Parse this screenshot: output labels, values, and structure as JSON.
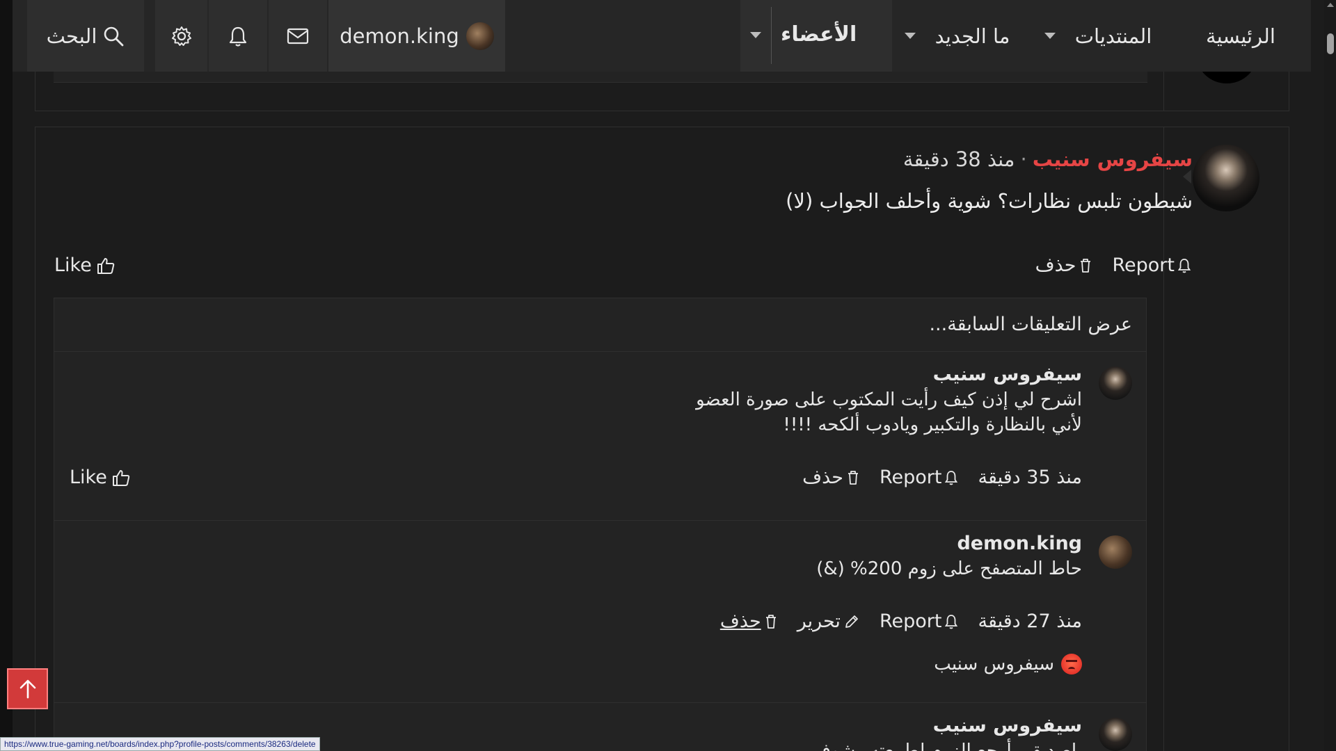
{
  "nav": {
    "home": "الرئيسية",
    "forums": "المنتديات",
    "whats_new": "ما الجديد",
    "members": "الأعضاء",
    "username": "demon.king",
    "search": "البحث"
  },
  "post": {
    "author": "سيفروس سنيب",
    "separator": "·",
    "time": "منذ 38 دقيقة",
    "body": "شيطون تلبس نظارات؟ شوية وأحلف الجواب (لا)",
    "report": "Report",
    "delete": "حذف",
    "like": "Like"
  },
  "comments": {
    "load_previous": "عرض التعليقات السابقة...",
    "items": [
      {
        "author": "سيفروس سنيب",
        "line1": "اشرح لي إذن كيف رأيت المكتوب على صورة العضو",
        "line2": "لأني بالنظارة والتكبير ويادوب ألكحه !!!!",
        "time": "منذ 35 دقيقة",
        "report": "Report",
        "delete": "حذف",
        "like": "Like"
      },
      {
        "author": "demon.king",
        "line1": "حاط المتصفح على زوم 200% (&)",
        "time": "منذ 27 دقيقة",
        "report": "Report",
        "edit": "تحرير",
        "delete": "حذف",
        "reaction_user": "سيفروس سنيب"
      },
      {
        "author": "سيفروس سنيب",
        "line1": "ياصديقي أرجع الزوم لطبيعته وشوف"
      }
    ]
  },
  "status_url": "https://www.true-gaming.net/boards/index.php?profile-posts/comments/38263/delete",
  "colors": {
    "accent_red": "#e64545",
    "nav_bg": "#262626",
    "page_bg": "#1c1c1c"
  }
}
